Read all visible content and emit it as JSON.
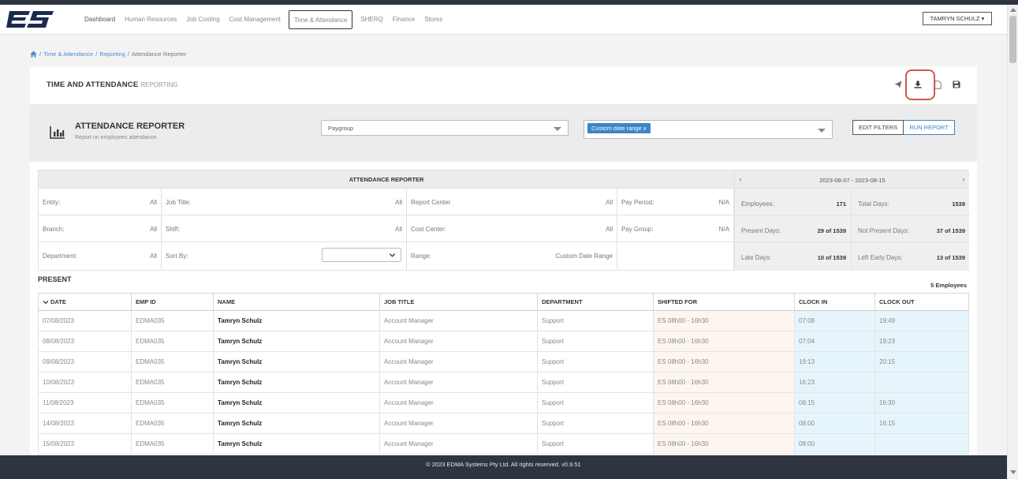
{
  "app": {
    "logo_text": "ES",
    "nav": [
      {
        "label": "Dashboard"
      },
      {
        "label": "Human Resources"
      },
      {
        "label": "Job Costing"
      },
      {
        "label": "Cost Management"
      },
      {
        "label": "Time & Attendance"
      },
      {
        "label": "SHERQ"
      },
      {
        "label": "Finance"
      },
      {
        "label": "Stores"
      }
    ],
    "user_menu": "TAMRYN SCHULZ ▾"
  },
  "breadcrumb": {
    "sep1": "/",
    "item1": "Time & Attendance",
    "sep2": "/",
    "item2": "Reporting",
    "sep3": "/",
    "current": "Attendance Reporter"
  },
  "header": {
    "title": "TIME AND ATTENDANCE",
    "subtitle": "REPORTING"
  },
  "reporter": {
    "title": "ATTENDANCE REPORTER",
    "description": "Report on employees attendance.",
    "paygroup_placeholder": "Paygroup",
    "date_chip": "Custom date range x",
    "edit_filters": "EDIT FILTERS",
    "run_report": "RUN REPORT"
  },
  "summary": {
    "heading": "ATTENDANCE REPORTER",
    "filters": [
      {
        "label": "Entity:",
        "value": "All"
      },
      {
        "label": "Job Title:",
        "value": "All"
      },
      {
        "label": "Report Center",
        "value": "All"
      },
      {
        "label": "Pay Period:",
        "value": "N/A"
      },
      {
        "label": "Branch:",
        "value": "All"
      },
      {
        "label": "Shift:",
        "value": "All"
      },
      {
        "label": "Cost Center:",
        "value": "All"
      },
      {
        "label": "Pay Group:",
        "value": "N/A"
      },
      {
        "label": "Department:",
        "value": "All"
      },
      {
        "label": "Sort By:",
        "value": ""
      },
      {
        "label": "Range:",
        "value": "Custom Date Range"
      }
    ],
    "date_range": "2023-08-07 - 2023-08-15",
    "prev": "‹",
    "next": "›",
    "stats": [
      {
        "label": "Employees:",
        "value": "171"
      },
      {
        "label": "Total Days:",
        "value": "1539"
      },
      {
        "label": "Present Days:",
        "value": "29 of 1539"
      },
      {
        "label": "Not Present Days:",
        "value": "37 of 1539"
      },
      {
        "label": "Late Days:",
        "value": "10 of 1539"
      },
      {
        "label": "Left Early Days:",
        "value": "13 of 1539"
      }
    ]
  },
  "present": {
    "section_title": "PRESENT",
    "employee_count": "5 Employees",
    "columns": [
      "DATE",
      "EMP ID",
      "NAME",
      "JOB TITLE",
      "DEPARTMENT",
      "SHIFTED FOR",
      "CLOCK IN",
      "CLOCK OUT"
    ],
    "rows": [
      [
        "07/08/2023",
        "EDMA035",
        "Tamryn Schulz",
        "Account Manager",
        "Support",
        "ES 08h00 - 16h30",
        "07:08",
        "19:49"
      ],
      [
        "08/08/2023",
        "EDMA035",
        "Tamryn Schulz",
        "Account Manager",
        "Support",
        "ES 08h00 - 16h30",
        "07:04",
        "19:23"
      ],
      [
        "09/08/2023",
        "EDMA035",
        "Tamryn Schulz",
        "Account Manager",
        "Support",
        "ES 08h00 - 16h30",
        "19:13",
        "20:15"
      ],
      [
        "10/08/2023",
        "EDMA035",
        "Tamryn Schulz",
        "Account Manager",
        "Support",
        "ES 08h00 - 16h30",
        "16:23",
        ""
      ],
      [
        "11/08/2023",
        "EDMA035",
        "Tamryn Schulz",
        "Account Manager",
        "Support",
        "ES 08h00 - 16h30",
        "08:15",
        "16:30"
      ],
      [
        "14/08/2023",
        "EDMA035",
        "Tamryn Schulz",
        "Account Manager",
        "Support",
        "ES 08h00 - 16h30",
        "08:00",
        "16:15"
      ],
      [
        "15/08/2023",
        "EDMA035",
        "Tamryn Schulz",
        "Account Manager",
        "Support",
        "ES 08h00 - 16h30",
        "08:00",
        ""
      ]
    ]
  },
  "footer": {
    "text": "© 2023 EDMA Systems Pty Ltd. All rights reserved. v0.9.51"
  },
  "colors": {
    "brand_dark": "#2f3540",
    "link_blue": "#4a8ad6",
    "accent_blue": "#3d85c6",
    "highlight_red": "#d0584c"
  },
  "icons": [
    "home-icon",
    "send-icon",
    "download-icon",
    "file-icon",
    "save-icon",
    "bar-chart-icon",
    "chevron-down-icon"
  ]
}
